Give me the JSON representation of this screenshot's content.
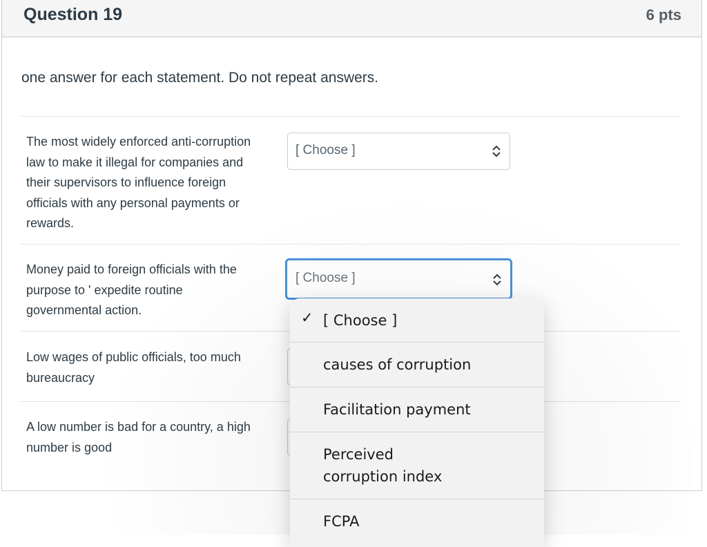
{
  "question": {
    "title": "Question 19",
    "points": "6 pts",
    "instructions": "one answer for each statement. Do not repeat answers."
  },
  "statements": [
    {
      "lines": [
        "The most widely enforced anti-corruption",
        "law to make it illegal for companies and",
        "their supervisors to influence foreign",
        "officials with any personal payments or",
        "rewards."
      ],
      "selected": "[ Choose ]"
    },
    {
      "lines": [
        "Money paid to foreign officials with the",
        "purpose to ' expedite routine",
        "governmental action."
      ],
      "selected": "[ Choose ]"
    },
    {
      "lines": [
        "Low wages of public officials, too much",
        "bureaucracy"
      ]
    },
    {
      "lines": [
        "A low number is bad for a country, a high",
        "number is good"
      ]
    }
  ],
  "dropdown": {
    "options": [
      {
        "label": "[ Choose ]",
        "checked": true
      },
      {
        "label": "causes of corruption"
      },
      {
        "label_lines": [
          "Perceived",
          "corruption index"
        ]
      },
      {
        "label": "Facilitation payment"
      },
      {
        "label": "FCPA"
      }
    ],
    "check_mark": "✓"
  },
  "colors": {
    "focus_ring": "#4a90d9",
    "header_bg": "#f5f5f5",
    "text": "#2d3b45"
  }
}
